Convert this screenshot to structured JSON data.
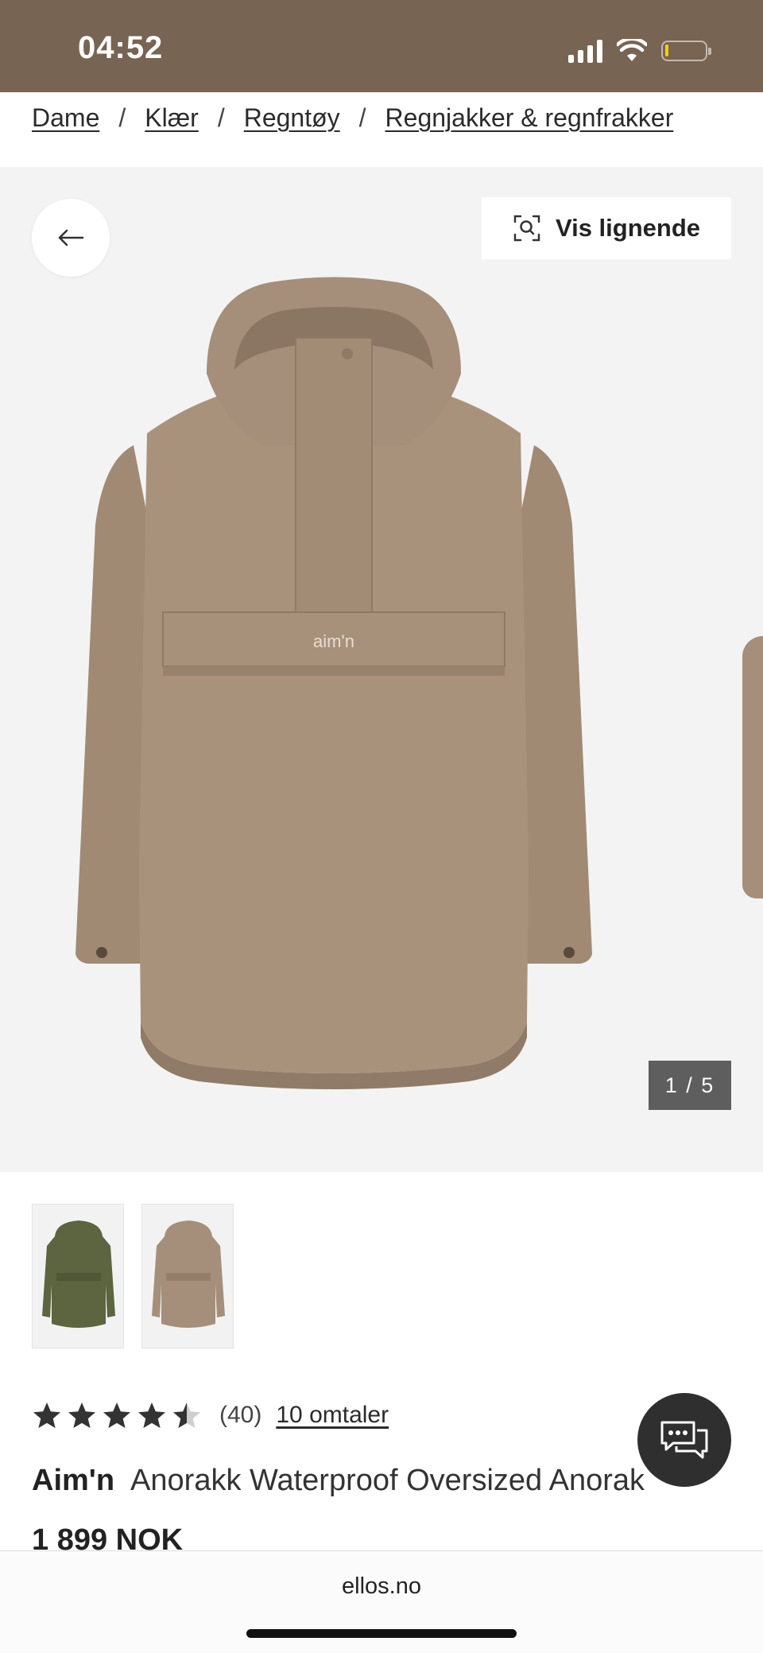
{
  "status_bar": {
    "time": "04:52",
    "icons": [
      "signal-icon",
      "wifi-icon",
      "battery-icon"
    ],
    "battery_level_percent": 8,
    "background": "#786452"
  },
  "breadcrumb": {
    "items": [
      "Dame",
      "Klær",
      "Regntøy",
      "Regnjakker & regnfrakker"
    ],
    "separator": "/"
  },
  "gallery": {
    "back_icon": "arrow-left-icon",
    "similar_label": "Vis lignende",
    "similar_icon": "visual-search-icon",
    "counter": "1 / 5",
    "image_logo_text": "aim'n",
    "image_color": "#a58f7a"
  },
  "thumbnails": [
    {
      "color_name": "olive",
      "color": "#5c6440"
    },
    {
      "color_name": "beige",
      "color": "#a58f7a"
    }
  ],
  "rating": {
    "value": 4.5,
    "max": 5,
    "count": "(40)",
    "reviews_label": "10 omtaler"
  },
  "product": {
    "brand": "Aim'n",
    "name": "Anorakk Waterproof Oversized Anorak",
    "price": "1 899 NOK"
  },
  "chat": {
    "icon": "chat-bubbles-icon"
  },
  "browser": {
    "url": "ellos.no"
  }
}
